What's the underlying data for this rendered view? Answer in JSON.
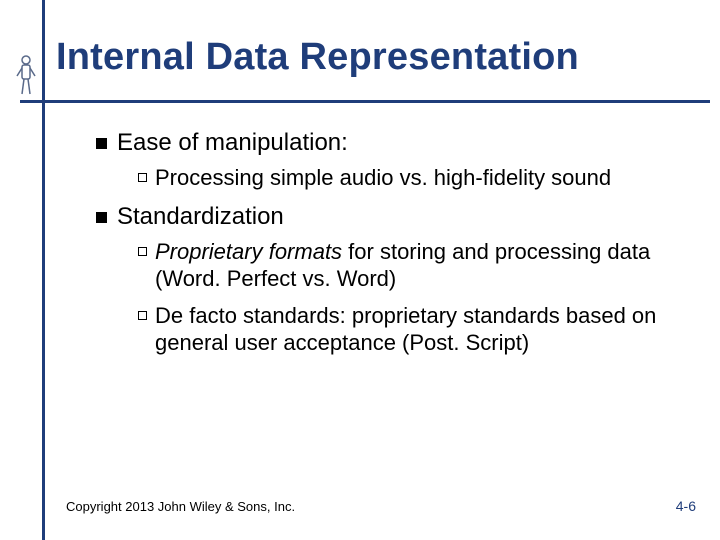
{
  "title": "Internal Data Representation",
  "bullets": [
    {
      "label": "Ease of manipulation:",
      "children": [
        {
          "pre_italic": "",
          "italic": "",
          "rest": "Processing simple audio vs. high-fidelity sound"
        }
      ]
    },
    {
      "label": "Standardization",
      "children": [
        {
          "pre_italic": "",
          "italic": "Proprietary formats",
          "rest": " for storing and processing data (Word. Perfect vs. Word)"
        },
        {
          "pre_italic": "De facto standards:  proprietary standards based on general user acceptance (Post. Script)",
          "italic": "",
          "rest": ""
        }
      ]
    }
  ],
  "footer": {
    "copyright": "Copyright 2013 John Wiley & Sons, Inc.",
    "page": "4-6"
  }
}
